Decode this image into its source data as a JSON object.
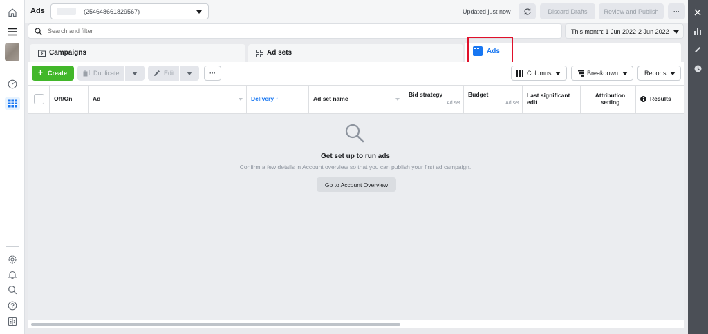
{
  "header": {
    "title": "Ads",
    "account_id": "(254648661829567)",
    "status": "Updated just now",
    "discard_label": "Discard Drafts",
    "publish_label": "Review and Publish",
    "more_label": "···"
  },
  "search": {
    "placeholder": "Search and filter"
  },
  "date_range": {
    "label": "This month: 1 Jun 2022-2 Jun 2022"
  },
  "tabs": [
    {
      "label": "Campaigns"
    },
    {
      "label": "Ad sets"
    },
    {
      "label": "Ads"
    }
  ],
  "toolbar": {
    "create_label": "Create",
    "duplicate_label": "Duplicate",
    "edit_label": "Edit",
    "more_label": "···",
    "columns_label": "Columns",
    "breakdown_label": "Breakdown",
    "reports_label": "Reports"
  },
  "table": {
    "columns": [
      {
        "label": "Off/On"
      },
      {
        "label": "Ad"
      },
      {
        "label": "Delivery ↑"
      },
      {
        "label": "Ad set name"
      },
      {
        "label": "Bid strategy",
        "sub": "Ad set"
      },
      {
        "label": "Budget",
        "sub": "Ad set"
      },
      {
        "label": "Last significant edit"
      },
      {
        "label": "Attribution setting"
      },
      {
        "label": "Results"
      }
    ]
  },
  "empty_state": {
    "title": "Get set up to run ads",
    "description": "Confirm a few details in Account overview so that you can publish your first ad campaign.",
    "button_label": "Go to Account Overview"
  },
  "colors": {
    "accent": "#1877f2",
    "create_green": "#42b72a",
    "highlight_red": "#e0112b",
    "right_rail": "#4b4f56"
  }
}
